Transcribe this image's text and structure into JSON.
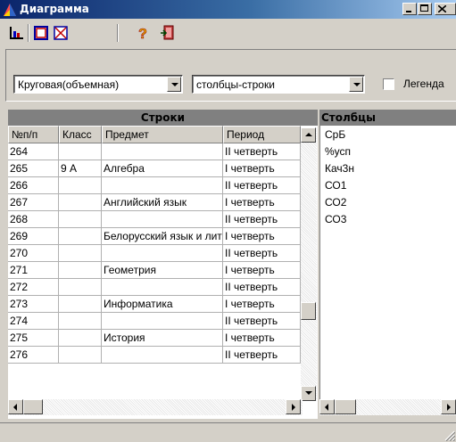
{
  "window": {
    "title": "Диаграмма",
    "title_icon": "chart-app-icon",
    "caption_buttons": [
      "minimize",
      "maximize",
      "close"
    ]
  },
  "toolbar": {
    "buttons": [
      {
        "icon": "bar-chart-icon"
      },
      {
        "icon": "frame-icon"
      },
      {
        "icon": "clear-icon"
      },
      {
        "icon": "help-icon"
      },
      {
        "icon": "exit-icon"
      }
    ]
  },
  "options": {
    "chart_type": "Круговая(объемная)",
    "orientation": "столбцы-строки",
    "legend_label": "Легенда",
    "legend_checked": false
  },
  "rows_panel": {
    "title": "Строки",
    "columns": [
      "№п/п",
      "Класс",
      "Предмет",
      "Период"
    ],
    "rows": [
      [
        "264",
        "",
        "",
        "II четверть"
      ],
      [
        "265",
        "9 А",
        "Алгебра",
        "I четверть"
      ],
      [
        "266",
        "",
        "",
        "II четверть"
      ],
      [
        "267",
        "",
        "Английский язык",
        "I четверть"
      ],
      [
        "268",
        "",
        "",
        "II четверть"
      ],
      [
        "269",
        "",
        "Белорусский язык и литература",
        "I четверть"
      ],
      [
        "270",
        "",
        "",
        "II четверть"
      ],
      [
        "271",
        "",
        "Геометрия",
        "I четверть"
      ],
      [
        "272",
        "",
        "",
        "II четверть"
      ],
      [
        "273",
        "",
        "Информатика",
        "I четверть"
      ],
      [
        "274",
        "",
        "",
        "II четверть"
      ],
      [
        "275",
        "",
        "История",
        "I четверть"
      ],
      [
        "276",
        "",
        "",
        "II четверть"
      ]
    ]
  },
  "cols_panel": {
    "title": "Столбцы",
    "items": [
      "СрБ",
      "%усп",
      "Кач3н",
      "СО1",
      "СО2",
      "СО3"
    ]
  },
  "colors": {
    "title_start": "#0a246a",
    "title_end": "#a6caf0",
    "face": "#d4d0c8",
    "header_band": "#808080"
  }
}
